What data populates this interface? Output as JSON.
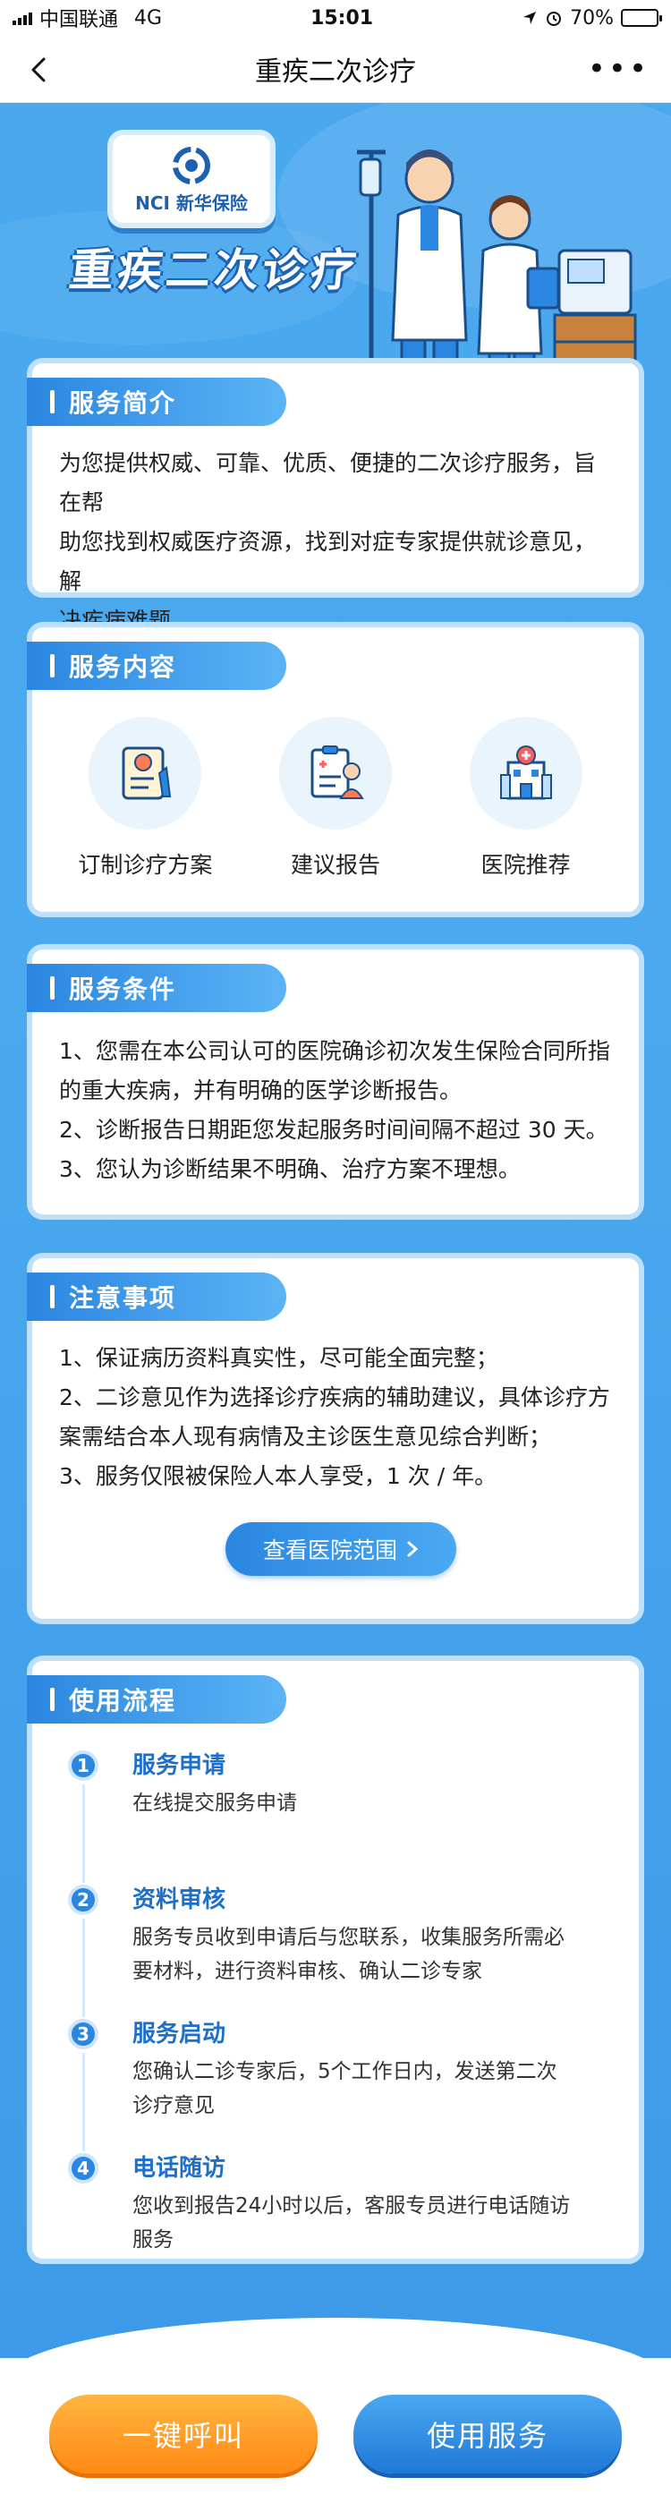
{
  "status_bar": {
    "carrier": "中国联通",
    "network": "4G",
    "time": "15:01",
    "battery": "70%",
    "battery_level": 0.7
  },
  "nav": {
    "title": "重疾二次诊疗",
    "more": "•••"
  },
  "hero": {
    "logo_text": "NCI 新华保险",
    "title": "重疾二次诊疗"
  },
  "intro": {
    "heading": "服务简介",
    "lines": [
      "为您提供权威、可靠、优质、便捷的二次诊疗服务，旨在帮",
      "助您找到权威医疗资源，找到对症专家提供就诊意见，解",
      "决疾病难题。"
    ]
  },
  "content": {
    "heading": "服务内容",
    "items": [
      {
        "label": "订制诊疗方案",
        "icon": "treatment-plan-icon"
      },
      {
        "label": "建议报告",
        "icon": "report-icon"
      },
      {
        "label": "医院推荐",
        "icon": "hospital-icon"
      }
    ]
  },
  "conditions": {
    "heading": "服务条件",
    "lines": [
      "1、您需在本公司认可的医院确诊初次发生保险合同所指",
      "的重大疾病，并有明确的医学诊断报告。",
      "2、诊断报告日期距您发起服务时间间隔不超过 30 天。",
      "3、您认为诊断结果不明确、治疗方案不理想。"
    ]
  },
  "notes": {
    "heading": "注意事项",
    "lines": [
      "1、保证病历资料真实性，尽可能全面完整；",
      "2、二诊意见作为选择诊疗疾病的辅助建议，具体诊疗方",
      "案需结合本人现有病情及主诊医生意见综合判断；",
      "3、服务仅限被保险人本人享受，1 次 / 年。"
    ],
    "button": "查看医院范围"
  },
  "process": {
    "heading": "使用流程",
    "steps": [
      {
        "num": "1",
        "title": "服务申请",
        "desc": [
          "在线提交服务申请"
        ]
      },
      {
        "num": "2",
        "title": "资料审核",
        "desc": [
          "服务专员收到申请后与您联系，收集服务所需必",
          "要材料，进行资料审核、确认二诊专家"
        ]
      },
      {
        "num": "3",
        "title": "服务启动",
        "desc": [
          "您确认二诊专家后，5个工作日内，发送第二次",
          "诊疗意见"
        ]
      },
      {
        "num": "4",
        "title": "电话随访",
        "desc": [
          "您收到报告24小时以后，客服专员进行电话随访",
          "服务"
        ]
      }
    ]
  },
  "footer": {
    "call_label": "一键呼叫",
    "use_label": "使用服务"
  },
  "colors": {
    "primary": "#2a86e0",
    "background": "#4aa8ee",
    "accent_orange": "#ff8a14"
  }
}
